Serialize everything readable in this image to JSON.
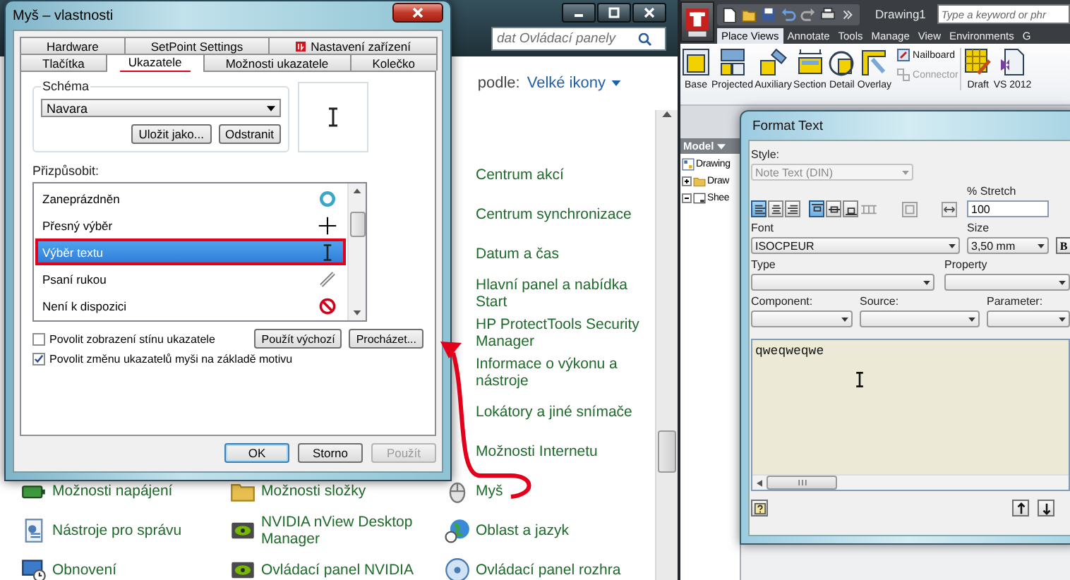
{
  "control_panel": {
    "search": {
      "placeholder": "dat Ovládací panely"
    },
    "view_by": {
      "label": "podle:",
      "value": "Velké ikony"
    },
    "columns": [
      {
        "items": [
          {
            "label": "Možnosti napájení",
            "kind": "power"
          },
          {
            "label": "Nástroje pro správu",
            "kind": "tools"
          },
          {
            "label": "Obnovení",
            "kind": "restore"
          }
        ]
      },
      {
        "items": [
          {
            "label": "Možnosti složky",
            "kind": "folder"
          },
          {
            "label": "NVIDIA nView Desktop Manager",
            "kind": "graphics"
          },
          {
            "label": "Ovládací panel NVIDIA",
            "kind": "graphics"
          }
        ]
      },
      {
        "items": [
          {
            "label": "Centrum akcí",
            "kind": "hidden"
          },
          {
            "label": "Centrum synchronizace",
            "kind": "hidden"
          },
          {
            "label": "Datum a čas",
            "kind": "hidden"
          },
          {
            "label": "Hlavní panel a nabídka Start",
            "kind": "hidden"
          },
          {
            "label": "HP ProtectTools Security Manager",
            "kind": "hidden"
          },
          {
            "label": "Informace o výkonu a nástroje",
            "kind": "hidden"
          },
          {
            "label": "Lokátory a jiné snímače",
            "kind": "hidden"
          },
          {
            "label": "Možnosti Internetu",
            "kind": "hidden"
          },
          {
            "label": "Myš",
            "kind": "mouse"
          },
          {
            "label": "Oblast a jazyk",
            "kind": "globe"
          },
          {
            "label": "Ovládací panel rozhra",
            "kind": "disc"
          }
        ]
      }
    ]
  },
  "mouse_dialog": {
    "title": "Myš – vlastnosti",
    "tabs_row_1": [
      {
        "label": "Hardware",
        "selected": false
      },
      {
        "label": "SetPoint Settings",
        "selected": false
      },
      {
        "label": "Nastavení zařízení",
        "selected": false,
        "kind": "device"
      }
    ],
    "tabs_row_2": [
      {
        "label": "Tlačítka",
        "selected": false
      },
      {
        "label": "Ukazatele",
        "selected": true
      },
      {
        "label": "Možnosti ukazatele",
        "selected": false
      },
      {
        "label": "Kolečko",
        "selected": false
      }
    ],
    "scheme": {
      "legend": "Schéma",
      "value": "Navara",
      "buttons": [
        "Uložit jako...",
        "Odstranit"
      ]
    },
    "customize_label": "Přizpůsobit:",
    "cursors": [
      {
        "label": "Zaneprázdněn",
        "kind": "busy",
        "selected": false
      },
      {
        "label": "Přesný výběr",
        "kind": "precision",
        "selected": false
      },
      {
        "label": "Výběr textu",
        "kind": "text",
        "selected": true
      },
      {
        "label": "Psaní rukou",
        "kind": "handwriting",
        "selected": false
      },
      {
        "label": "Není k dispozici",
        "kind": "unavailable",
        "selected": false
      }
    ],
    "shadow_checkbox": {
      "label": "Povolit zobrazení stínu ukazatele",
      "checked": false
    },
    "list_buttons": [
      "Použít výchozí",
      "Procházet..."
    ],
    "theme_checkbox": {
      "label": "Povolit změnu ukazatelů myši na základě motivu",
      "checked": true
    },
    "footer_buttons": [
      {
        "label": "OK",
        "disabled": false
      },
      {
        "label": "Storno",
        "disabled": false
      },
      {
        "label": "Použít",
        "disabled": true
      }
    ]
  },
  "inventor": {
    "title": "Drawing1",
    "search": {
      "placeholder": "Type a keyword or phr"
    },
    "tabs": [
      {
        "label": "Place Views",
        "selected": true
      },
      {
        "label": "Annotate",
        "selected": false
      },
      {
        "label": "Tools",
        "selected": false
      },
      {
        "label": "Manage",
        "selected": false
      },
      {
        "label": "View",
        "selected": false
      },
      {
        "label": "Environments",
        "selected": false
      },
      {
        "label": "G",
        "selected": false
      }
    ],
    "panels": [
      {
        "tools": [
          {
            "label": "Base",
            "kind": "large",
            "disabled": false
          },
          {
            "label": "Projected",
            "kind": "large",
            "disabled": false
          },
          {
            "label": "Auxiliary",
            "kind": "large",
            "disabled": false
          },
          {
            "label": "Section",
            "kind": "large",
            "disabled": false
          },
          {
            "label": "Detail",
            "kind": "large",
            "disabled": false
          },
          {
            "label": "Overlay",
            "kind": "large",
            "disabled": false
          },
          {
            "label": "Nailboard",
            "kind": "small",
            "disabled": false
          },
          {
            "label": "Connector",
            "kind": "small",
            "disabled": true
          }
        ]
      },
      {
        "tools": [
          {
            "label": "Draft",
            "kind": "large",
            "disabled": false
          },
          {
            "label": "VS 2012",
            "kind": "large",
            "disabled": false
          }
        ]
      }
    ],
    "browser": {
      "label": "Model",
      "tree": [
        {
          "label": "Drawing",
          "kind": "drawing",
          "children": [
            {
              "label": "Draw",
              "kind": "folder",
              "expanded": false
            },
            {
              "label": "Shee",
              "kind": "sheet",
              "expanded": true
            }
          ]
        }
      ]
    }
  },
  "format_text": {
    "title": "Format Text",
    "style": {
      "label": "Style:",
      "value": "Note Text (DIN)",
      "disabled": true
    },
    "h_align": [
      {
        "selected": true
      },
      {
        "selected": false
      },
      {
        "selected": false
      }
    ],
    "v_align": [
      {
        "selected": true
      },
      {
        "selected": false
      },
      {
        "selected": false
      }
    ],
    "stretch": {
      "label": "% Stretch",
      "value": "100"
    },
    "font": {
      "label": "Font",
      "value": "ISOCPEUR"
    },
    "size": {
      "label": "Size",
      "value": "3,50 mm"
    },
    "bold_button": {
      "label": "B"
    },
    "type": {
      "label": "Type"
    },
    "property": {
      "label": "Property"
    },
    "component": {
      "label": "Component:"
    },
    "source": {
      "label": "Source:"
    },
    "parameter": {
      "label": "Parameter:"
    },
    "text": "qweqweqwe"
  }
}
